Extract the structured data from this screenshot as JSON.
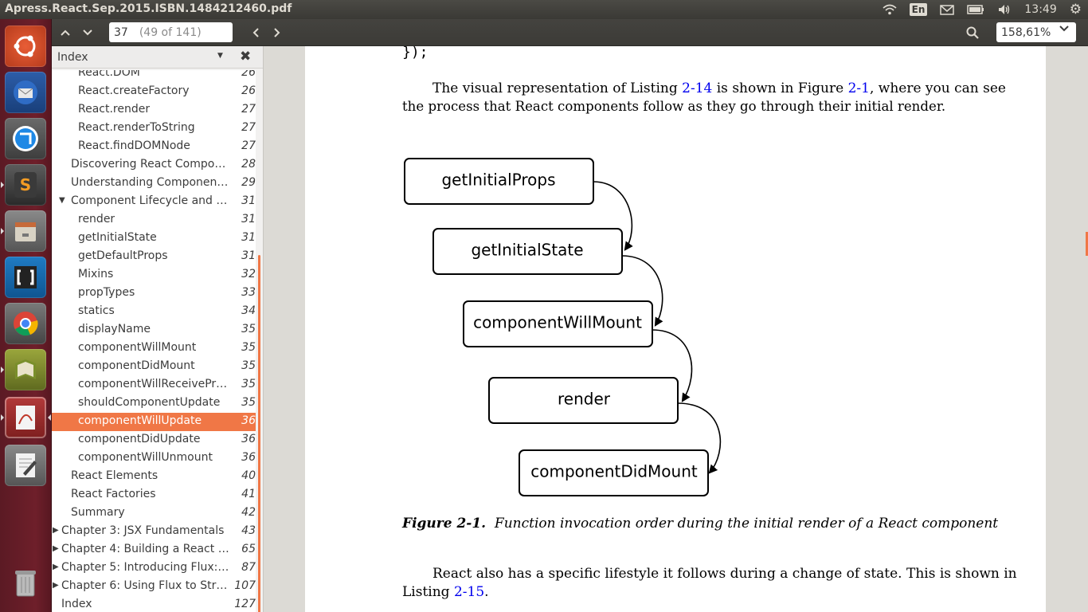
{
  "window": {
    "title": "Apress.React.Sep.2015.ISBN.1484212460.pdf"
  },
  "tray": {
    "keyboard": "En",
    "time": "13:49"
  },
  "toolbar": {
    "page_current": "37",
    "page_total": "(49 of 141)",
    "zoom": "158,61%"
  },
  "sidebar": {
    "view_label": "Index",
    "items": [
      {
        "label": "React.DOM",
        "page": "26",
        "level": 2
      },
      {
        "label": "React.createFactory",
        "page": "26",
        "level": 2
      },
      {
        "label": "React.render",
        "page": "27",
        "level": 2
      },
      {
        "label": "React.renderToString",
        "page": "27",
        "level": 2
      },
      {
        "label": "React.findDOMNode",
        "page": "27",
        "level": 2
      },
      {
        "label": "Discovering React Compon…",
        "page": "28",
        "level": 1
      },
      {
        "label": "Understanding Component…",
        "page": "29",
        "level": 1
      },
      {
        "label": "Component Lifecycle and R…",
        "page": "31",
        "level": 1,
        "expanded": true
      },
      {
        "label": "render",
        "page": "31",
        "level": 2
      },
      {
        "label": "getInitialState",
        "page": "31",
        "level": 2
      },
      {
        "label": "getDefaultProps",
        "page": "31",
        "level": 2
      },
      {
        "label": "Mixins",
        "page": "32",
        "level": 2
      },
      {
        "label": "propTypes",
        "page": "33",
        "level": 2
      },
      {
        "label": "statics",
        "page": "34",
        "level": 2
      },
      {
        "label": "displayName",
        "page": "35",
        "level": 2
      },
      {
        "label": "componentWillMount",
        "page": "35",
        "level": 2
      },
      {
        "label": "componentDidMount",
        "page": "35",
        "level": 2
      },
      {
        "label": "componentWillReceivePr…",
        "page": "35",
        "level": 2
      },
      {
        "label": "shouldComponentUpdate",
        "page": "35",
        "level": 2
      },
      {
        "label": "componentWillUpdate",
        "page": "36",
        "level": 2,
        "selected": true
      },
      {
        "label": "componentDidUpdate",
        "page": "36",
        "level": 2
      },
      {
        "label": "componentWillUnmount",
        "page": "36",
        "level": 2
      },
      {
        "label": "React Elements",
        "page": "40",
        "level": 1
      },
      {
        "label": "React Factories",
        "page": "41",
        "level": 1
      },
      {
        "label": "Summary",
        "page": "42",
        "level": 1
      },
      {
        "label": "Chapter 3: JSX Fundamentals",
        "page": "43",
        "level": 0,
        "collapsed": true
      },
      {
        "label": "Chapter 4: Building a React W…",
        "page": "65",
        "level": 0,
        "collapsed": true
      },
      {
        "label": "Chapter 5: Introducing Flux: …",
        "page": "87",
        "level": 0,
        "collapsed": true
      },
      {
        "label": "Chapter 6: Using Flux to Stru…",
        "page": "107",
        "level": 0,
        "collapsed": true
      },
      {
        "label": "Index",
        "page": "127",
        "level": 0
      }
    ]
  },
  "document": {
    "code_line": "});",
    "para1_line1_a": "The visual representation of Listing ",
    "para1_link1": "2-14",
    "para1_line1_b": " is shown in Figure ",
    "para1_link2": "2-1",
    "para1_line1_c": ", where you can see",
    "para1_line2": "the process that React components follow as they go through their initial render.",
    "figure_nodes": [
      "getInitialProps",
      "getInitialState",
      "componentWillMount",
      "render",
      "componentDidMount"
    ],
    "caption_label": "Figure 2-1.",
    "caption_text": "Function invocation order during the initial render of a React component",
    "para2_line1": "React also has a specific lifestyle it follows during a change of state. This is shown in",
    "para2_line2_a": "Listing ",
    "para2_link": "2-15",
    "para2_line2_b": "."
  },
  "colors": {
    "accent": "#f07746",
    "launcher": "#6e1f2a",
    "link": "#0000ee"
  },
  "launcher_icons": [
    "ubuntu-dash-icon",
    "thunderbird-icon",
    "app-blue-icon",
    "sublime-text-icon",
    "files-icon",
    "brackets-icon",
    "chrome-icon",
    "ebook-reader-icon",
    "document-viewer-icon",
    "text-editor-icon",
    "trash-icon"
  ]
}
